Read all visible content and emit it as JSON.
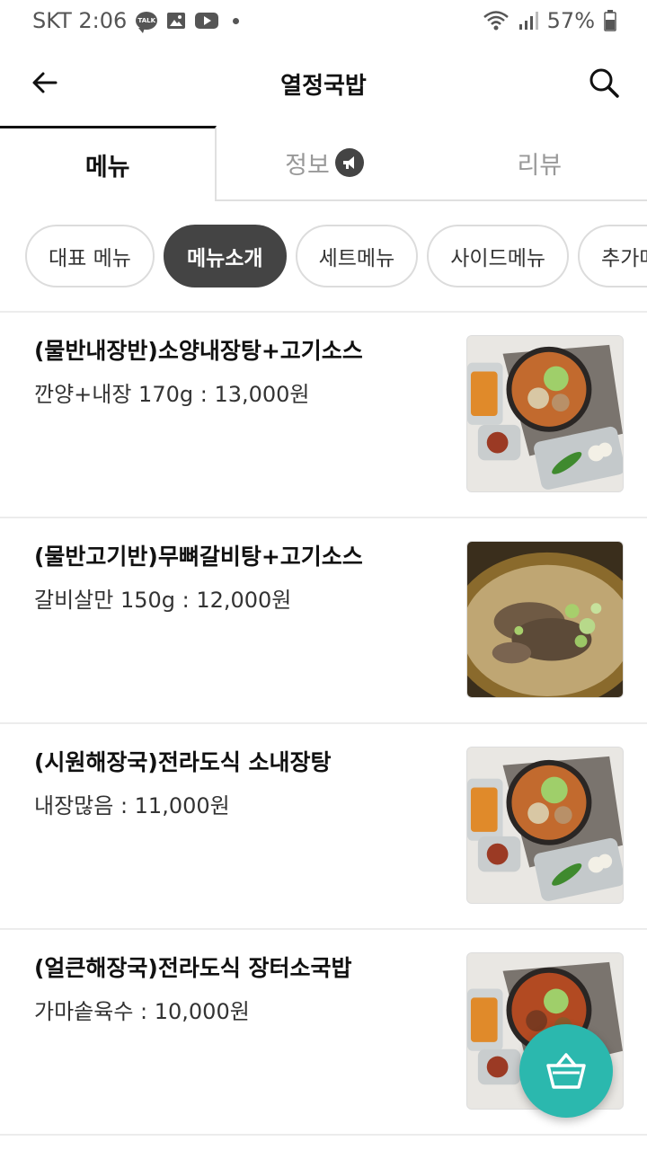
{
  "status_bar": {
    "carrier_time": "SKT 2:06",
    "talk_badge": "TALK",
    "battery": "57%"
  },
  "app_bar": {
    "title": "열정국밥"
  },
  "tabs": [
    {
      "label": "메뉴",
      "active": true
    },
    {
      "label": "정보",
      "active": false
    },
    {
      "label": "리뷰",
      "active": false
    }
  ],
  "chips": [
    {
      "label": "대표 메뉴",
      "active": false
    },
    {
      "label": "메뉴소개",
      "active": true
    },
    {
      "label": "세트메뉴",
      "active": false
    },
    {
      "label": "사이드메뉴",
      "active": false
    },
    {
      "label": "추가메뉴",
      "active": false
    }
  ],
  "menu_items": [
    {
      "name": "(물반내장반)소양내장탕+고기소스",
      "desc": "깐양+내장 170g : 13,000원",
      "photo": "soup-tray"
    },
    {
      "name": "(물반고기반)무뼈갈비탕+고기소스",
      "desc": "갈비살만 150g : 12,000원",
      "photo": "galbi-soup"
    },
    {
      "name": "(시원해장국)전라도식 소내장탕",
      "desc": "내장많음 : 11,000원",
      "photo": "soup-tray"
    },
    {
      "name": "(얼큰해장국)전라도식 장터소국밥",
      "desc": "가마솥육수 : 10,000원",
      "photo": "soup-tray"
    }
  ],
  "colors": {
    "accent_teal": "#2bb8ae",
    "active_chip": "#444444"
  }
}
